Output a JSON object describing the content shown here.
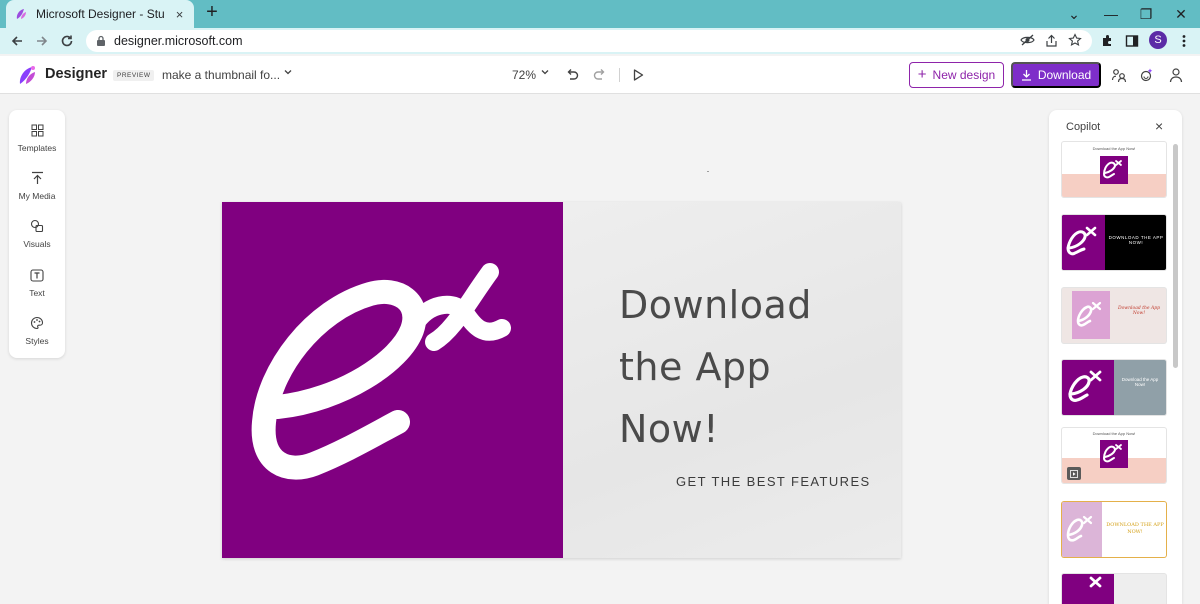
{
  "browser": {
    "tab_title": "Microsoft Designer - Stunning de",
    "tab_close": "×",
    "new_tab": "+",
    "url": "designer.microsoft.com",
    "profile_initial": "S",
    "window_controls": {
      "minimize": "⌄",
      "min": "—",
      "restore": "❐",
      "close": "✕"
    }
  },
  "app": {
    "name": "Designer",
    "badge": "PREVIEW",
    "design_name": "make a thumbnail fo...",
    "zoom": "72%",
    "new_design_label": "New design",
    "download_label": "Download",
    "brand_color": "#7e2ec9"
  },
  "rail": {
    "items": [
      {
        "label": "Templates",
        "icon": "templates-icon"
      },
      {
        "label": "My Media",
        "icon": "upload-icon"
      },
      {
        "label": "Visuals",
        "icon": "visuals-icon"
      },
      {
        "label": "Text",
        "icon": "text-icon"
      },
      {
        "label": "Styles",
        "icon": "styles-icon"
      }
    ]
  },
  "artboard": {
    "headline_lines": [
      "Download",
      "the App",
      "Now!"
    ],
    "subline": "GET THE BEST FEATURES",
    "logo_text": "ex",
    "colors": {
      "purple": "#800080",
      "gray": "#ebebeb",
      "text": "#4a4a4a"
    }
  },
  "copilot": {
    "title": "Copilot",
    "close": "×",
    "thumbnails": [
      {
        "caption": "Download the App Now!"
      },
      {
        "caption": "DOWNLOAD THE APP NOW!"
      },
      {
        "caption": "Download the App Now!"
      },
      {
        "caption": "Download the App Now!"
      },
      {
        "caption": "Download the App Now!"
      },
      {
        "caption": "DOWNLOAD THE APP NOW!"
      }
    ]
  }
}
